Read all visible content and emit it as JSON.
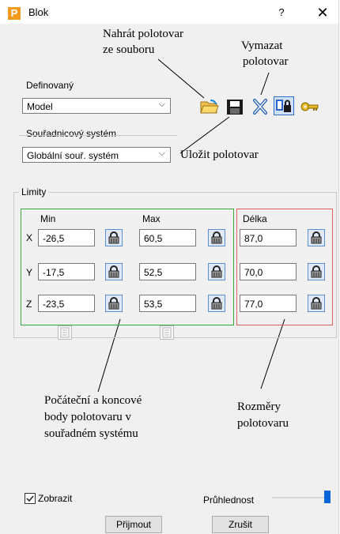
{
  "window": {
    "icon_letter": "P",
    "title": "Blok",
    "help_glyph": "?",
    "close_glyph": "✕"
  },
  "annotations": {
    "load": [
      "Nahrát polotovar",
      "ze souboru"
    ],
    "delete": [
      "Vymazat",
      "polotovar"
    ],
    "save": "Uložit polotovar",
    "points": [
      "Počáteční a koncové",
      "body polotovaru v",
      "souřadném systému"
    ],
    "dims": [
      "Rozměry",
      "polotovaru"
    ]
  },
  "defined": {
    "label": "Definovaný",
    "value": "Model"
  },
  "coord": {
    "label": "Souřadnicový systém",
    "value": "Globální souř. systém"
  },
  "limits": {
    "caption": "Limity",
    "min_header": "Min",
    "max_header": "Max",
    "len_header": "Délka",
    "rows": [
      {
        "axis": "X",
        "min": "-26,5",
        "max": "60,5",
        "len": "87,0"
      },
      {
        "axis": "Y",
        "min": "-17,5",
        "max": "52,5",
        "len": "70,0"
      },
      {
        "axis": "Z",
        "min": "-23,5",
        "max": "53,5",
        "len": "77,0"
      }
    ]
  },
  "footer": {
    "show_label": "Zobrazit",
    "show_checked": true,
    "transparency_label": "Průhlednost",
    "transparency_level": 1.0,
    "accept": "Přijmout",
    "cancel": "Zrušit"
  },
  "icons": [
    "open-folder-icon",
    "save-disk-icon",
    "delete-x-icon",
    "stock-lock-icon",
    "key-icon",
    "lock-icon",
    "table-icon",
    "checkbox-check-icon"
  ],
  "colors": {
    "min_max_box": "#3aa83a",
    "length_box": "#e06060",
    "accent": "#0a64d8"
  }
}
